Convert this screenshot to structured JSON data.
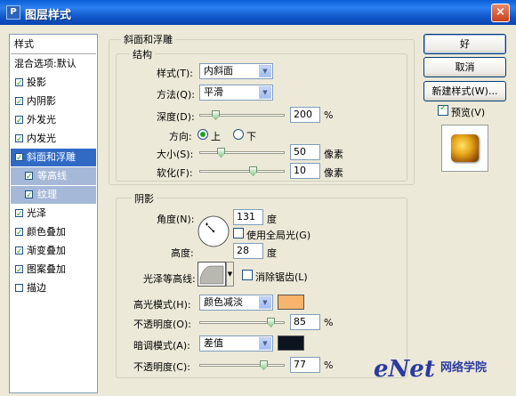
{
  "window": {
    "title": "图层样式",
    "close": "×"
  },
  "style_list": {
    "header": "样式",
    "blend": "混合选项:默认",
    "items": [
      {
        "label": "投影",
        "checked": true
      },
      {
        "label": "内阴影",
        "checked": true
      },
      {
        "label": "外发光",
        "checked": true
      },
      {
        "label": "内发光",
        "checked": true
      },
      {
        "label": "斜面和浮雕",
        "checked": true
      },
      {
        "label": "等高线",
        "checked": true
      },
      {
        "label": "纹理",
        "checked": true
      },
      {
        "label": "光泽",
        "checked": true
      },
      {
        "label": "颜色叠加",
        "checked": true
      },
      {
        "label": "渐变叠加",
        "checked": true
      },
      {
        "label": "图案叠加",
        "checked": true
      },
      {
        "label": "描边",
        "checked": false
      }
    ]
  },
  "bevel": {
    "group_title": "斜面和浮雕",
    "structure_title": "结构",
    "style_label": "样式(T):",
    "style_value": "内斜面",
    "technique_label": "方法(Q):",
    "technique_value": "平滑",
    "depth_label": "深度(D):",
    "depth_value": "200",
    "depth_unit": "%",
    "direction_label": "方向:",
    "dir_up": "上",
    "dir_down": "下",
    "size_label": "大小(S):",
    "size_value": "50",
    "size_unit": "像素",
    "soften_label": "软化(F):",
    "soften_value": "10",
    "soften_unit": "像素"
  },
  "shading": {
    "title": "阴影",
    "angle_label": "角度(N):",
    "angle_value": "131",
    "angle_unit": "度",
    "global_light_label": "使用全局光(G)",
    "global_light_checked": false,
    "altitude_label": "高度:",
    "altitude_value": "28",
    "altitude_unit": "度",
    "gloss_label": "光泽等高线:",
    "anti_alias_label": "消除锯齿(L)",
    "anti_alias_checked": false,
    "highlight_mode_label": "高光模式(H):",
    "highlight_mode_value": "颜色减淡",
    "highlight_color": "#f6b46c",
    "hl_opacity_label": "不透明度(O):",
    "hl_opacity_value": "85",
    "hl_opacity_unit": "%",
    "shadow_mode_label": "暗调模式(A):",
    "shadow_mode_value": "差值",
    "shadow_color": "#0c1420",
    "sh_opacity_label": "不透明度(C):",
    "sh_opacity_value": "77",
    "sh_opacity_unit": "%"
  },
  "buttons": {
    "ok": "好",
    "cancel": "取消",
    "new_style": "新建样式(W)...",
    "preview": "预览(V)",
    "preview_checked": true
  },
  "watermark": {
    "brand": "eNet",
    "cn": "网络学院"
  }
}
